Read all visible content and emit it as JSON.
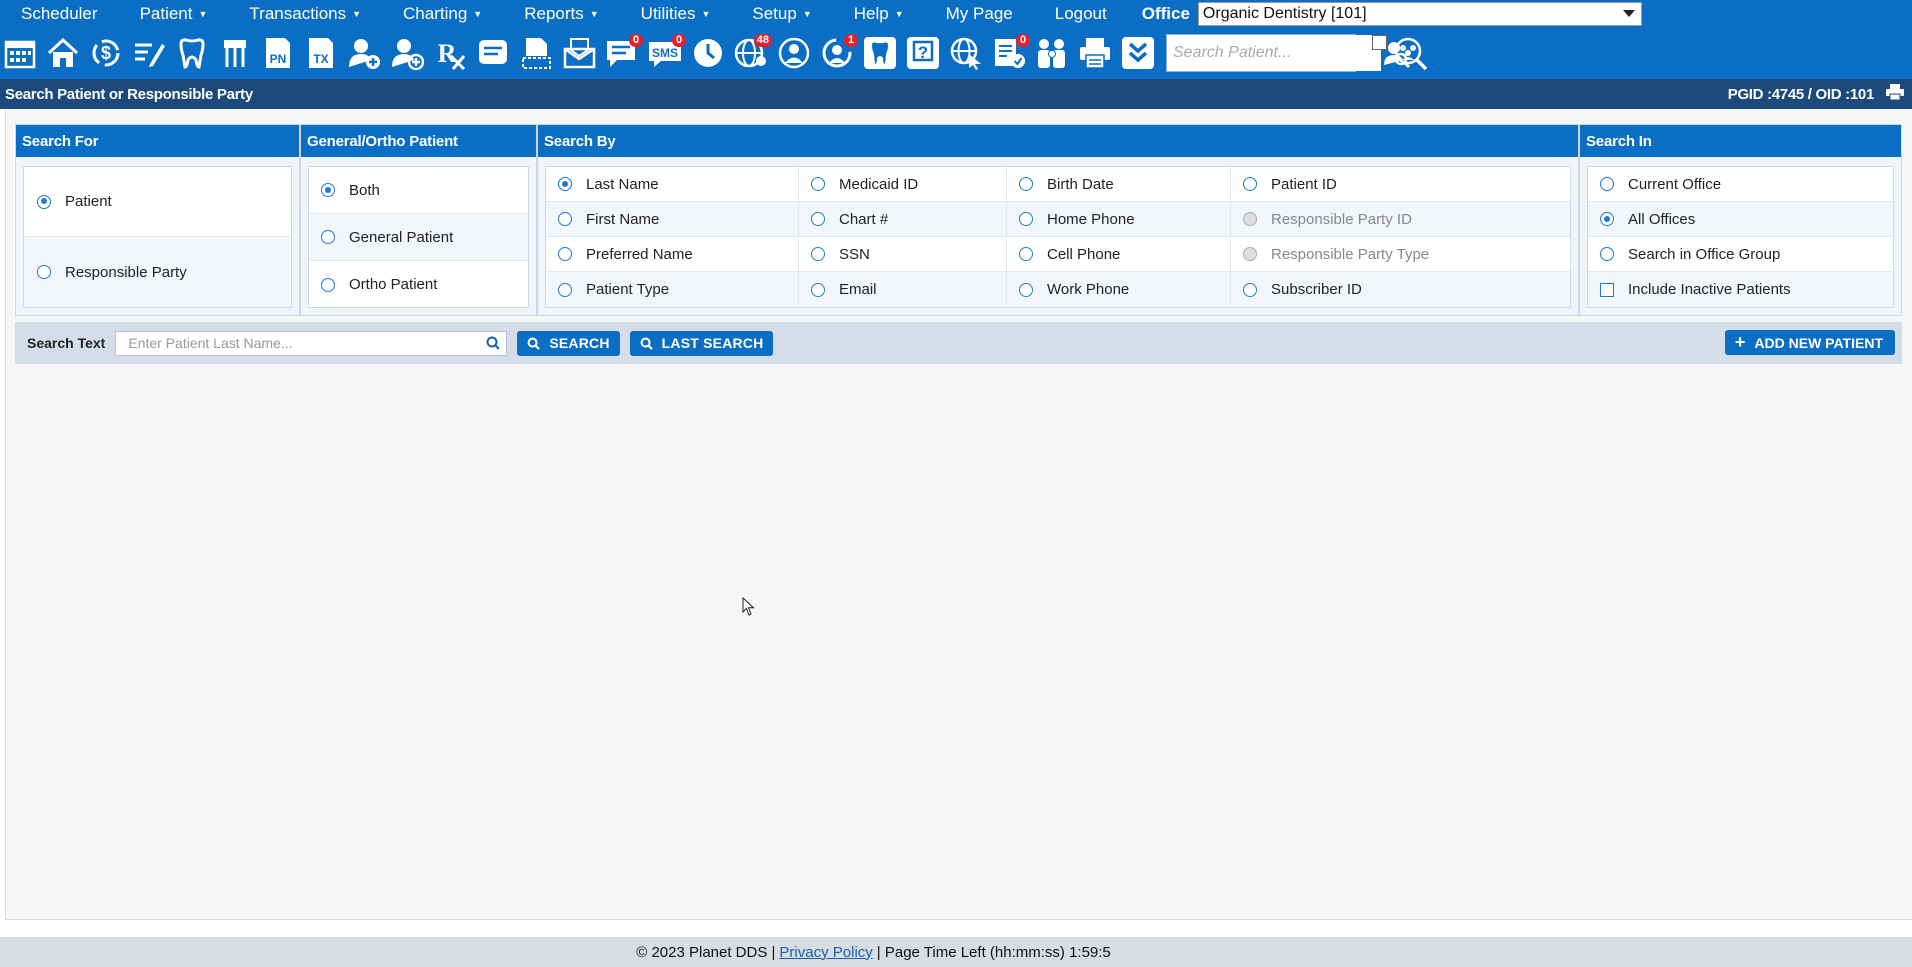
{
  "menu": {
    "items": [
      {
        "label": "Scheduler",
        "caret": false
      },
      {
        "label": "Patient",
        "caret": true
      },
      {
        "label": "Transactions",
        "caret": true
      },
      {
        "label": "Charting",
        "caret": true
      },
      {
        "label": "Reports",
        "caret": true
      },
      {
        "label": "Utilities",
        "caret": true
      },
      {
        "label": "Setup",
        "caret": true
      },
      {
        "label": "Help",
        "caret": true
      },
      {
        "label": "My Page",
        "caret": false
      },
      {
        "label": "Logout",
        "caret": false
      }
    ],
    "office_label": "Office",
    "office_value": "Organic Dentistry [101]"
  },
  "toolbar": {
    "icons": [
      {
        "name": "calendar-icon",
        "text": ""
      },
      {
        "name": "home-icon",
        "text": ""
      },
      {
        "name": "dollar-icon",
        "text": ""
      },
      {
        "name": "edit-list-icon",
        "text": ""
      },
      {
        "name": "tooth-icon",
        "text": ""
      },
      {
        "name": "tooth-roots-icon",
        "text": ""
      },
      {
        "name": "progress-notes-icon",
        "text": "PN"
      },
      {
        "name": "treatment-icon",
        "text": "TX"
      },
      {
        "name": "add-patient-icon",
        "text": ""
      },
      {
        "name": "add-responsible-icon",
        "text": ""
      },
      {
        "name": "prescription-icon",
        "text": "Rx"
      },
      {
        "name": "notes-icon",
        "text": ""
      },
      {
        "name": "document-icon",
        "text": ""
      },
      {
        "name": "mail-icon",
        "text": ""
      },
      {
        "name": "messages-icon",
        "text": "",
        "badge": "0"
      },
      {
        "name": "sms-icon",
        "text": "SMS",
        "badge": "0"
      },
      {
        "name": "clock-icon",
        "text": ""
      },
      {
        "name": "online-patients-icon",
        "text": "",
        "badge": "48"
      },
      {
        "name": "globe-icon",
        "text": ""
      },
      {
        "name": "recall-icon",
        "text": "",
        "badge": "1"
      },
      {
        "name": "tooth-tile-icon",
        "text": ""
      },
      {
        "name": "help-tile-icon",
        "text": "?"
      },
      {
        "name": "web-icon",
        "text": ""
      },
      {
        "name": "forms-icon",
        "text": "",
        "badge": "0"
      },
      {
        "name": "family-icon",
        "text": ""
      },
      {
        "name": "print-icon",
        "text": ""
      },
      {
        "name": "expand-icon",
        "text": ""
      }
    ],
    "search_placeholder": "Search Patient..."
  },
  "title": {
    "text": "Search Patient or Responsible Party",
    "ids": "PGID :4745  /  OID :101"
  },
  "search_for": {
    "header": "Search For",
    "options": [
      {
        "label": "Patient",
        "checked": true
      },
      {
        "label": "Responsible Party",
        "checked": false
      }
    ]
  },
  "general_ortho": {
    "header": "General/Ortho Patient",
    "options": [
      {
        "label": "Both",
        "checked": true
      },
      {
        "label": "General Patient",
        "checked": false
      },
      {
        "label": "Ortho Patient",
        "checked": false
      }
    ]
  },
  "search_by": {
    "header": "Search By",
    "rows": [
      [
        "Last Name",
        "Medicaid ID",
        "Birth Date",
        "Patient ID"
      ],
      [
        "First Name",
        "Chart #",
        "Home Phone",
        "Responsible Party ID"
      ],
      [
        "Preferred Name",
        "SSN",
        "Cell Phone",
        "Responsible Party Type"
      ],
      [
        "Patient Type",
        "Email",
        "Work Phone",
        "Subscriber ID"
      ]
    ],
    "checked": "Last Name",
    "disabled": [
      "Responsible Party ID",
      "Responsible Party Type"
    ]
  },
  "search_in": {
    "header": "Search In",
    "options": [
      {
        "label": "Current Office",
        "checked": false
      },
      {
        "label": "All Offices",
        "checked": true
      },
      {
        "label": "Search in Office Group",
        "checked": false
      }
    ],
    "include_inactive_label": "Include Inactive Patients"
  },
  "search_text": {
    "label": "Search Text",
    "placeholder": "Enter Patient Last Name...",
    "search_label": "SEARCH",
    "last_search_label": "LAST SEARCH",
    "add_label": "ADD NEW PATIENT"
  },
  "footer": {
    "copyright": "© 2023 Planet DDS |",
    "privacy": "Privacy Policy",
    "time_left": "|  Page Time Left (hh:mm:ss) 1:59:5"
  },
  "colors": {
    "brand_blue": "#0b6ec5",
    "title_bar": "#1c4a7a",
    "badge_red": "#e8202a"
  }
}
